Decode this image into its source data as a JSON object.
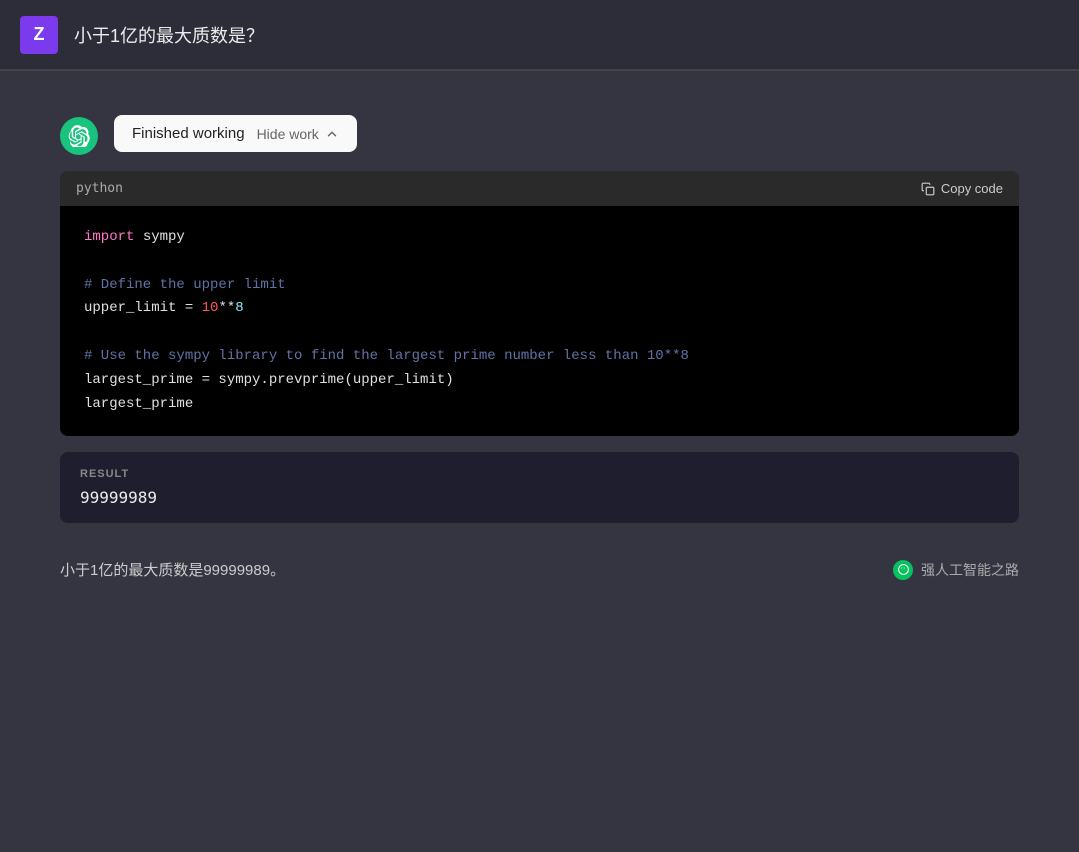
{
  "header": {
    "user_initial": "Z",
    "title": "小于1亿的最大质数是？"
  },
  "assistant": {
    "finished_label": "Finished working",
    "hide_work_label": "Hide work",
    "code_lang": "python",
    "copy_code_label": "Copy code",
    "code_lines": [
      {
        "type": "import",
        "content": "import sympy"
      },
      {
        "type": "blank"
      },
      {
        "type": "comment",
        "content": "# Define the upper limit"
      },
      {
        "type": "code",
        "content": "upper_limit = 10**8"
      },
      {
        "type": "blank"
      },
      {
        "type": "comment",
        "content": "# Use the sympy library to find the largest prime number less than 10**8"
      },
      {
        "type": "code",
        "content": "largest_prime = sympy.prevprime(upper_limit)"
      },
      {
        "type": "code",
        "content": "largest_prime"
      }
    ],
    "result_label": "RESULT",
    "result_value": "99999989",
    "footer_text": "小于1亿的最大质数是99999989。",
    "watermark_text": "强人工智能之路"
  }
}
